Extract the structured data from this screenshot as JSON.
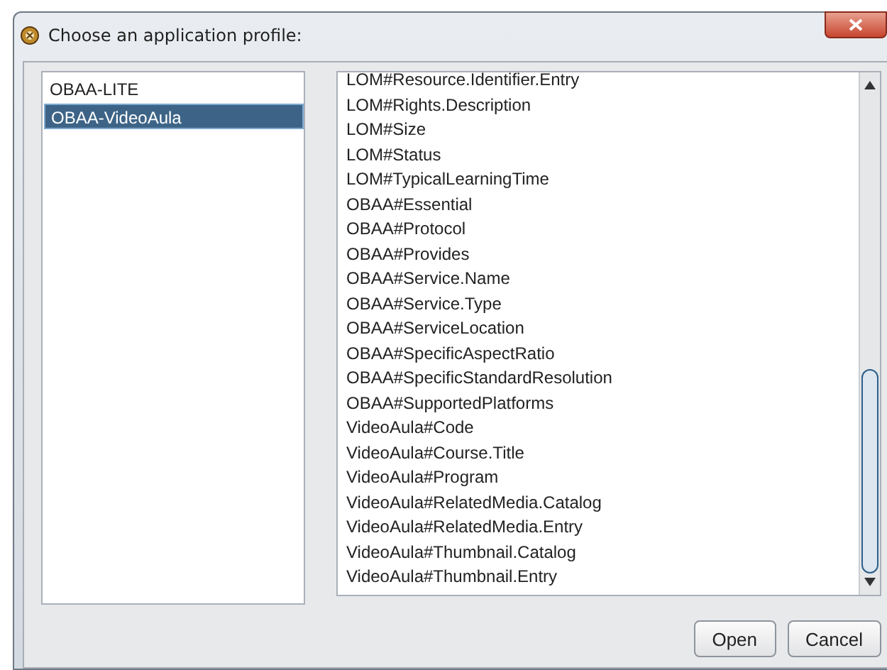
{
  "window": {
    "title": "Choose an application profile:"
  },
  "profiles": [
    {
      "label": "OBAA-LITE",
      "selected": false
    },
    {
      "label": "OBAA-VideoAula",
      "selected": true
    }
  ],
  "fields": [
    "LOM#Resource.Identifier.Entry",
    "LOM#Rights.Description",
    "LOM#Size",
    "LOM#Status",
    "LOM#TypicalLearningTime",
    "OBAA#Essential",
    "OBAA#Protocol",
    "OBAA#Provides",
    "OBAA#Service.Name",
    "OBAA#Service.Type",
    "OBAA#ServiceLocation",
    "OBAA#SpecificAspectRatio",
    "OBAA#SpecificStandardResolution",
    "OBAA#SupportedPlatforms",
    "VideoAula#Code",
    "VideoAula#Course.Title",
    "VideoAula#Program",
    "VideoAula#RelatedMedia.Catalog",
    "VideoAula#RelatedMedia.Entry",
    "VideoAula#Thumbnail.Catalog",
    "VideoAula#Thumbnail.Entry"
  ],
  "buttons": [
    "Open",
    "Cancel"
  ]
}
